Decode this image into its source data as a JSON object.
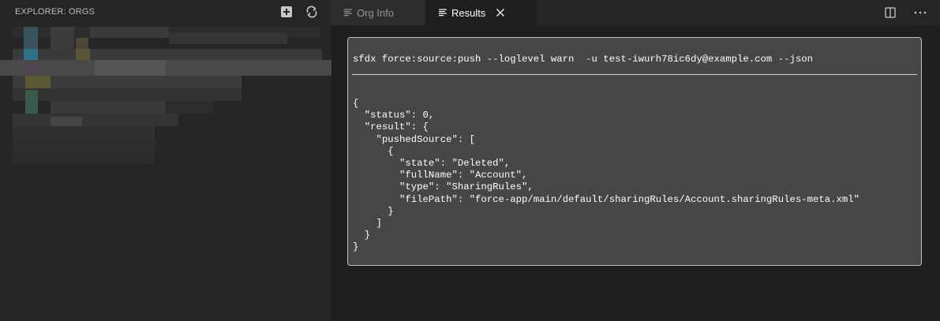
{
  "sidebar": {
    "title": "EXPLORER: ORGS",
    "actions": [
      {
        "name": "add-icon"
      },
      {
        "name": "refresh-icon"
      }
    ]
  },
  "tabs": [
    {
      "label": "Org Info",
      "icon": "preview-icon",
      "active": false
    },
    {
      "label": "Results",
      "icon": "preview-icon",
      "active": true,
      "closable": true
    }
  ],
  "editor_actions": [
    {
      "name": "split-editor-icon"
    },
    {
      "name": "more-actions-icon"
    }
  ],
  "result": {
    "command": "sfdx force:source:push --loglevel warn  -u test-iwurh78ic6dy@example.com --json",
    "output": "{\n  \"status\": 0,\n  \"result\": {\n    \"pushedSource\": [\n      {\n        \"state\": \"Deleted\",\n        \"fullName\": \"Account\",\n        \"type\": \"SharingRules\",\n        \"filePath\": \"force-app/main/default/sharingRules/Account.sharingRules-meta.xml\"\n      }\n    ]\n  }\n}"
  },
  "colors": {
    "sidebar_bg": "#252526",
    "editor_bg": "#1e1e1e",
    "result_bg": "#464646",
    "active_tab_text": "#ffffff",
    "inactive_tab_text": "#969696"
  }
}
